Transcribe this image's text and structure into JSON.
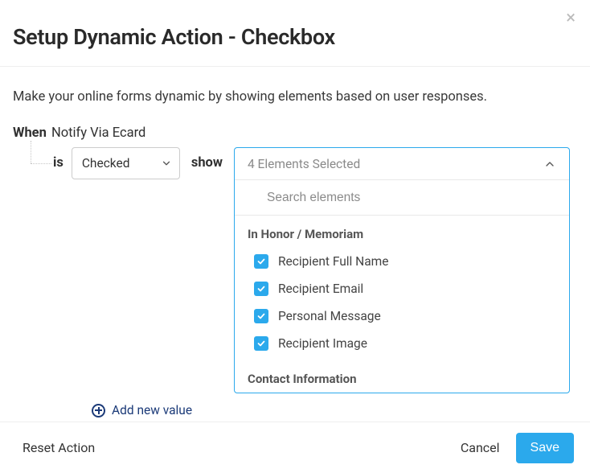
{
  "modal": {
    "close_label": "×",
    "title": "Setup Dynamic Action - Checkbox",
    "description": "Make your online forms dynamic by showing elements based on user responses."
  },
  "condition": {
    "when_label": "When",
    "when_value": "Notify Via Ecard",
    "is_label": "is",
    "state_value": "Checked",
    "show_label": "show"
  },
  "multiselect": {
    "summary": "4 Elements Selected",
    "search_placeholder": "Search elements",
    "groups": [
      {
        "label": "In Honor / Memoriam",
        "options": [
          {
            "label": "Recipient Full Name",
            "checked": true
          },
          {
            "label": "Recipient Email",
            "checked": true
          },
          {
            "label": "Personal Message",
            "checked": true
          },
          {
            "label": "Recipient Image",
            "checked": true
          }
        ]
      },
      {
        "label": "Contact Information",
        "options": []
      }
    ]
  },
  "add_new_label": "Add new value",
  "footer": {
    "reset": "Reset Action",
    "cancel": "Cancel",
    "save": "Save"
  }
}
